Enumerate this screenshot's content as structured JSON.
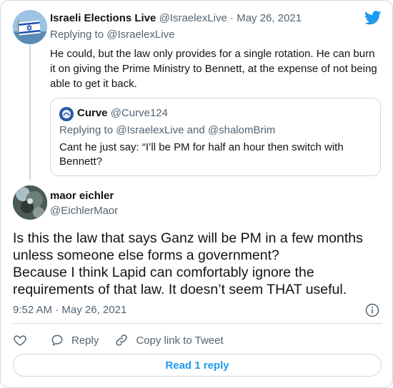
{
  "colors": {
    "link": "#1d9bf0",
    "muted": "#536471",
    "text": "#0f1419",
    "border": "#cfd9de"
  },
  "parent_tweet": {
    "name": "Israeli Elections Live",
    "handle": "@IsraelexLive",
    "separator": "·",
    "date": "May 26, 2021",
    "replying_to_label": "Replying to",
    "replying_to": "@IsraelexLive",
    "text": "He could, but the law only provides for a single rotation. He can burn it on giving the Prime Ministry to Bennett, at the expense of not being able to get it back.",
    "avatar_icon": "israel-flag-avatar"
  },
  "quoted_tweet": {
    "name": "Curve",
    "handle": "@Curve124",
    "replying_to_label": "Replying to",
    "replying_to_1": "@IsraelexLive",
    "replying_to_and": "and",
    "replying_to_2": "@shalomBrim",
    "text": "Cant he just say: “I’ll be PM for half an hour then switch with Bennett?",
    "avatar_icon": "curve-logo-avatar"
  },
  "main_tweet": {
    "name": "maor eichler",
    "handle": "@EichlerMaor",
    "text_line1": "Is this the law that says Ganz will be PM in a few months unless someone else forms a government?",
    "text_line2": "Because I think Lapid can comfortably ignore the requirements of that law. It doesn’t seem THAT useful.",
    "time": "9:52 AM",
    "separator": "·",
    "date": "May 26, 2021",
    "avatar_icon": "profile-photo-avatar"
  },
  "actions": {
    "like_icon": "heart-icon",
    "reply_icon": "reply-icon",
    "reply_label": "Reply",
    "copy_icon": "link-icon",
    "copy_label": "Copy link to Tweet"
  },
  "read_replies_label": "Read 1 reply"
}
